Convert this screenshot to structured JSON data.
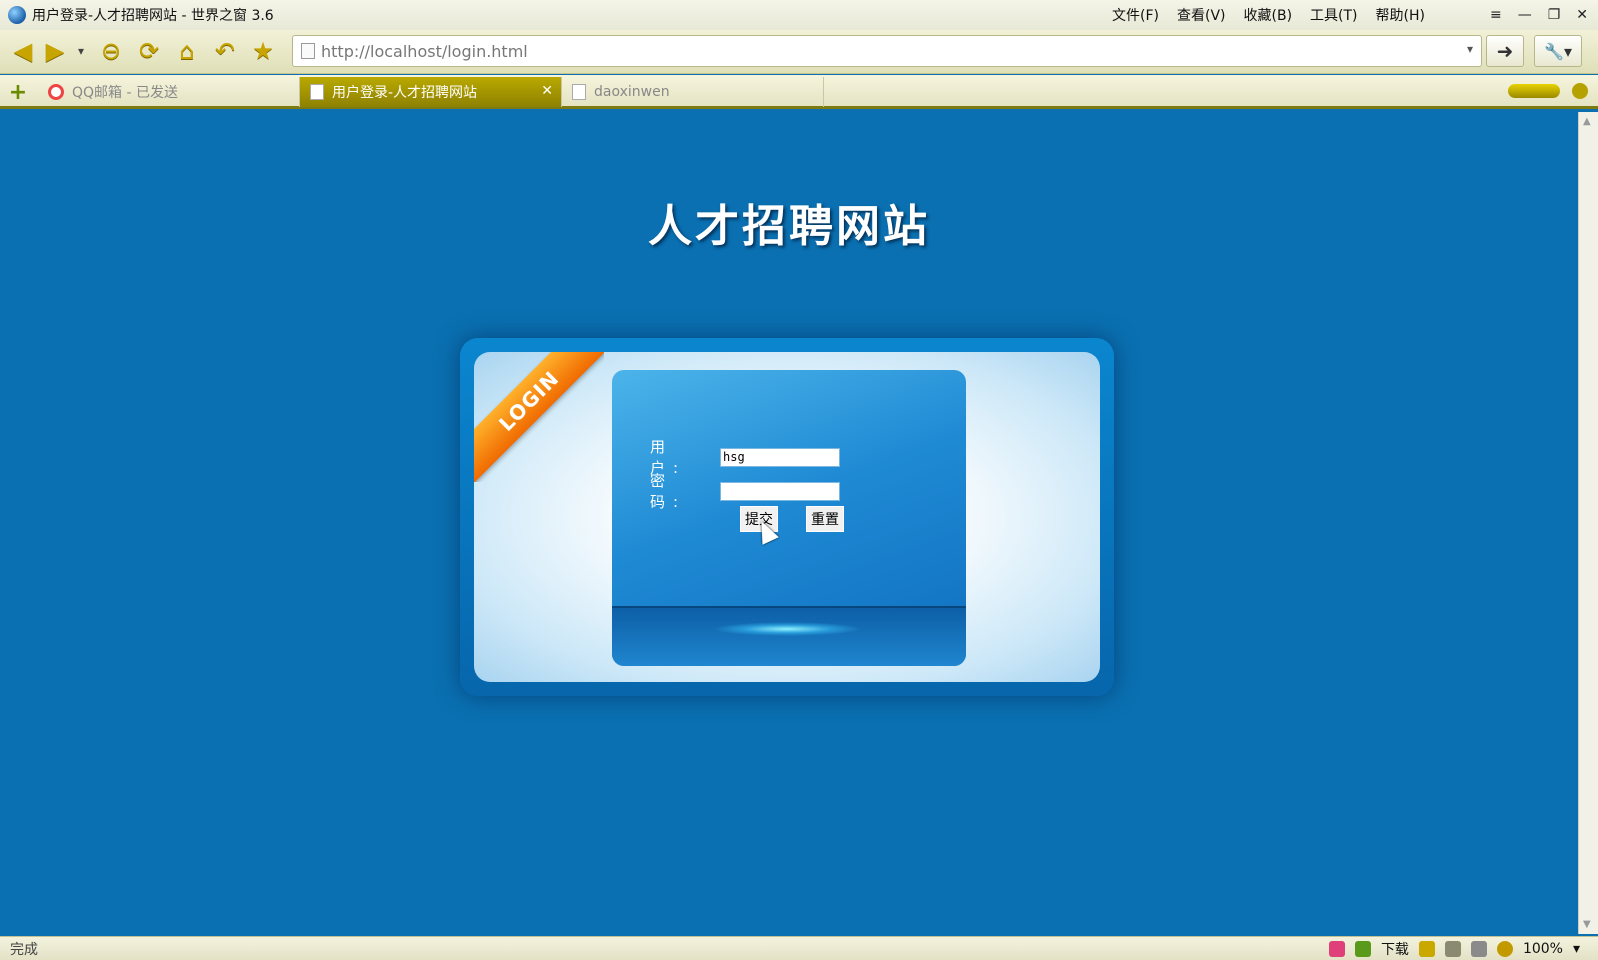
{
  "window": {
    "title": "用户登录-人才招聘网站 - 世界之窗 3.6",
    "menus": [
      "文件(F)",
      "查看(V)",
      "收藏(B)",
      "工具(T)",
      "帮助(H)"
    ],
    "controls": [
      "≡",
      "—",
      "❐",
      "✕"
    ]
  },
  "toolbar": {
    "back": "◀",
    "forward": "▶",
    "history_dropdown": "▾",
    "stop": "⊖",
    "refresh": "⟳",
    "home": "⌂",
    "undo": "↶",
    "favorite": "★",
    "address_url": "http://localhost/login.html",
    "address_dropdown": "▾",
    "go": "➜",
    "tools": "🔧▾"
  },
  "tabs": [
    {
      "label": "QQ邮箱 - 已发送",
      "active": false
    },
    {
      "label": "用户登录-人才招聘网站",
      "active": true
    },
    {
      "label": "daoxinwen",
      "active": false
    }
  ],
  "tab_add": "+",
  "tab_close": "✕",
  "page": {
    "site_title": "人才招聘网站",
    "ribbon": "LOGIN",
    "username_label": "用 户:",
    "username_value": "hsg",
    "password_label": "密 码:",
    "password_value": "",
    "submit_label": "提交",
    "reset_label": "重置"
  },
  "status": {
    "text": "完成",
    "download_label": "下载",
    "zoom": "100%",
    "zoom_dropdown": "▾"
  },
  "colors": {
    "page_background": "#0a70b1",
    "ribbon": "#f06a00",
    "tab_active": "#a09300"
  }
}
